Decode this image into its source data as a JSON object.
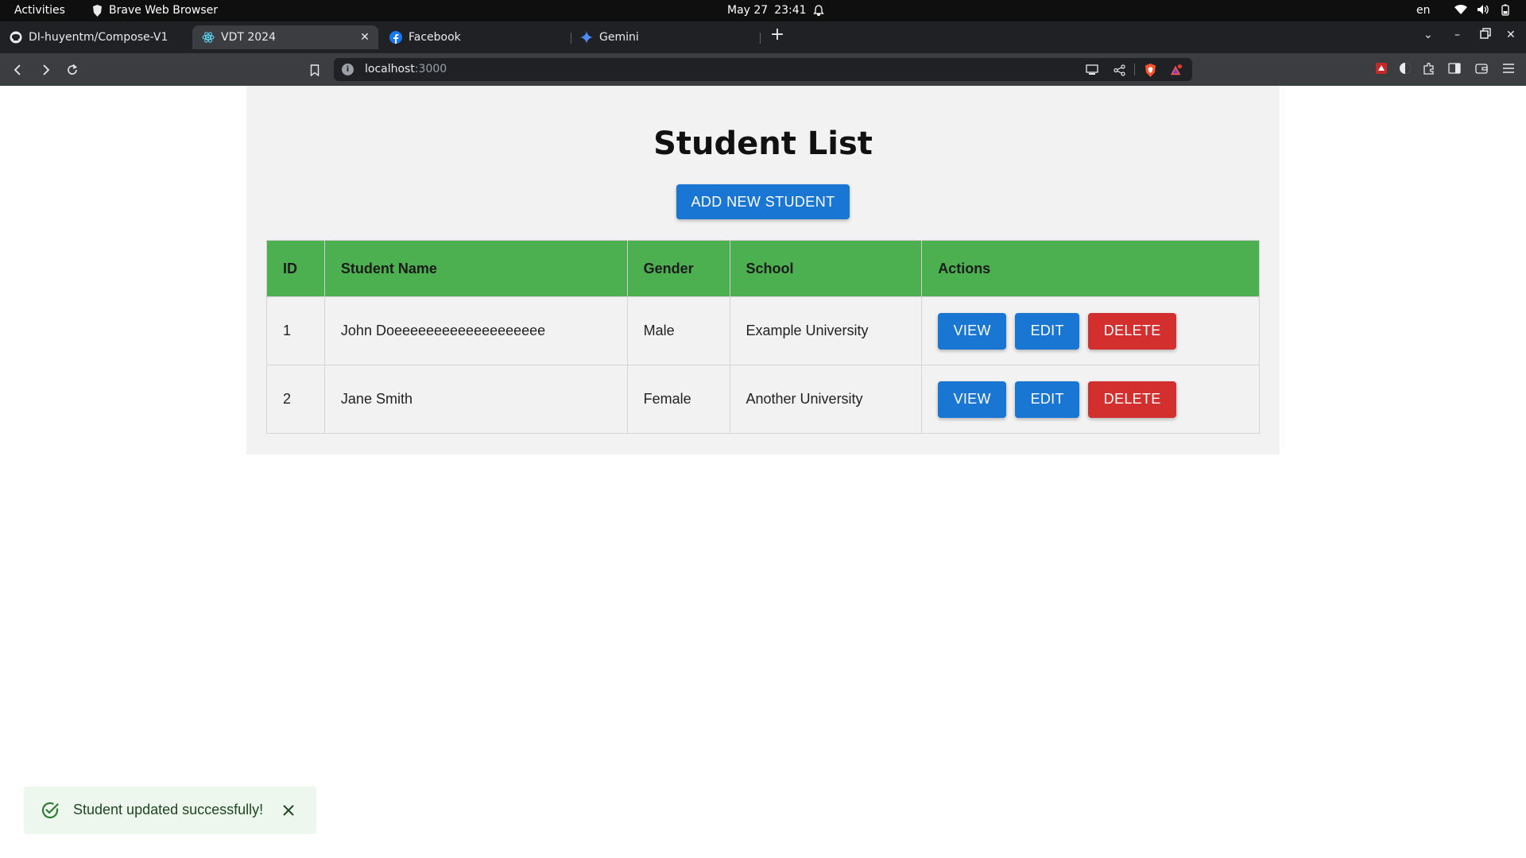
{
  "system_bar": {
    "activities": "Activities",
    "app_name": "Brave Web Browser",
    "date": "May 27",
    "time": "23:41",
    "lang": "en"
  },
  "tabs": [
    {
      "label": "DI-huyentm/Compose-V1",
      "icon": "github-icon"
    },
    {
      "label": "VDT 2024",
      "icon": "react-icon",
      "active": true
    },
    {
      "label": "Facebook",
      "icon": "facebook-icon"
    },
    {
      "label": "Gemini",
      "icon": "gemini-icon"
    }
  ],
  "address": {
    "host": "localhost",
    "port": ":3000"
  },
  "page": {
    "title": "Student List",
    "add_button": "ADD NEW STUDENT",
    "columns": [
      "ID",
      "Student Name",
      "Gender",
      "School",
      "Actions"
    ],
    "rows": [
      {
        "id": "1",
        "name": "John Doeeeeeeeeeeeeeeeeeee",
        "gender": "Male",
        "school": "Example University"
      },
      {
        "id": "2",
        "name": "Jane Smith",
        "gender": "Female",
        "school": "Another University"
      }
    ],
    "actions": {
      "view": "VIEW",
      "edit": "EDIT",
      "delete": "DELETE"
    }
  },
  "toast": {
    "message": "Student updated successfully!"
  },
  "colors": {
    "primary": "#1976d2",
    "danger": "#d32f2f",
    "header_green": "#4caf50",
    "toast_bg": "#edf7ed"
  }
}
